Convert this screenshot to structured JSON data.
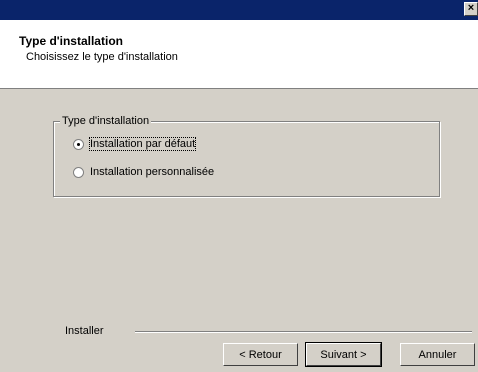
{
  "window": {
    "close_glyph": "×"
  },
  "header": {
    "title": "Type d'installation",
    "subtitle": "Choisissez le type d'installation"
  },
  "install_type_group": {
    "legend": "Type d'installation",
    "options": [
      {
        "label": "Installation par défaut",
        "selected": true
      },
      {
        "label": "Installation personnalisée",
        "selected": false
      }
    ]
  },
  "footer": {
    "installer_label": "Installer",
    "back_label": "< Retour",
    "next_label": "Suivant >",
    "cancel_label": "Annuler"
  },
  "colors": {
    "title_bar": "#0a246a",
    "dialog_face": "#d4d0c8",
    "header_background": "#ffffff"
  }
}
